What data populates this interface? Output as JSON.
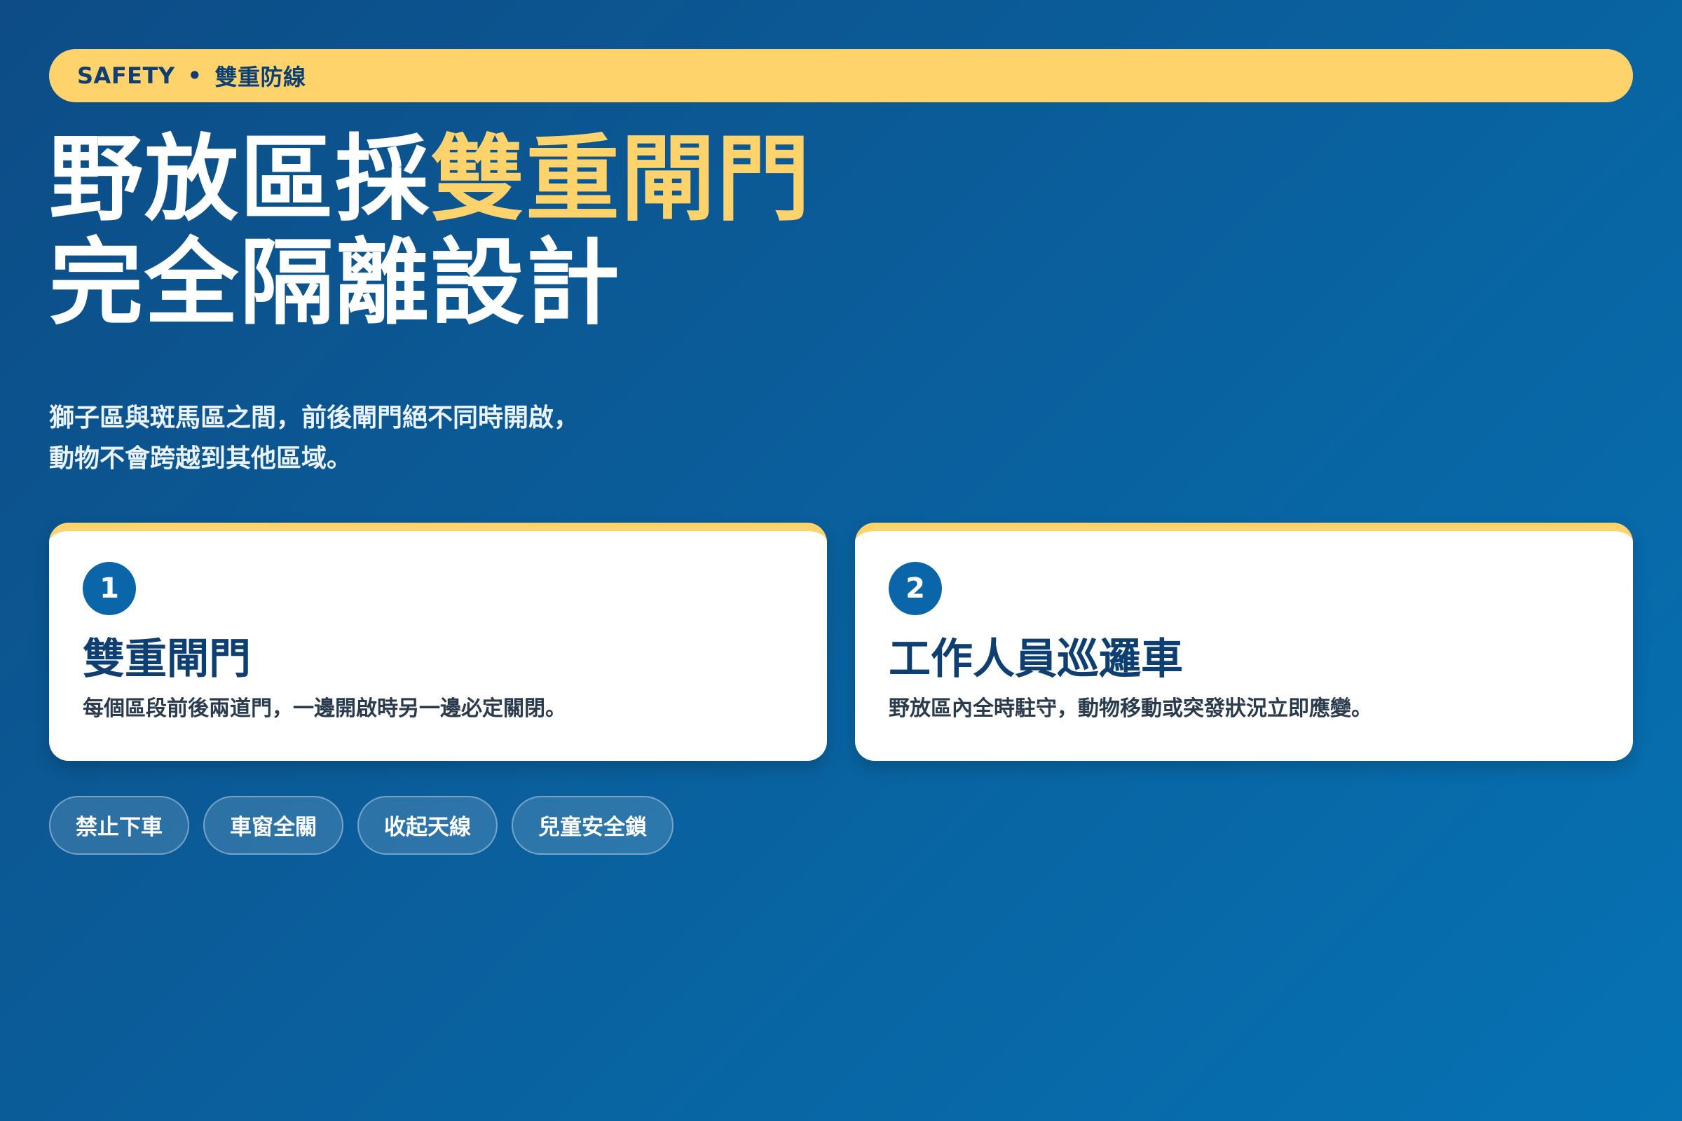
{
  "top_label": {
    "category": "SAFETY",
    "separator": "•",
    "topic": "雙重防線"
  },
  "headline": {
    "line1_plain": "野放區採",
    "line1_highlight": "雙重閘門",
    "line2": "完全隔離設計"
  },
  "subtext": {
    "line1": "獅子區與斑馬區之間，前後閘門絕不同時開啟，",
    "line2": "動物不會跨越到其他區域。"
  },
  "cards": [
    {
      "number": "1",
      "title": "雙重閘門",
      "description": "每個區段前後兩道門，一邊開啟時另一邊必定關閉。"
    },
    {
      "number": "2",
      "title": "工作人員巡邏車",
      "description": "野放區內全時駐守，動物移動或突發狀況立即應變。"
    }
  ],
  "tags": [
    "禁止下車",
    "車窗全關",
    "收起天線",
    "兒童安全鎖"
  ],
  "colors": {
    "background_start": "#0d4c86",
    "background_end": "#0672b3",
    "accent_yellow": "#ffd36b",
    "navy_text": "#0d3f73",
    "badge_blue": "#0a66a8"
  }
}
